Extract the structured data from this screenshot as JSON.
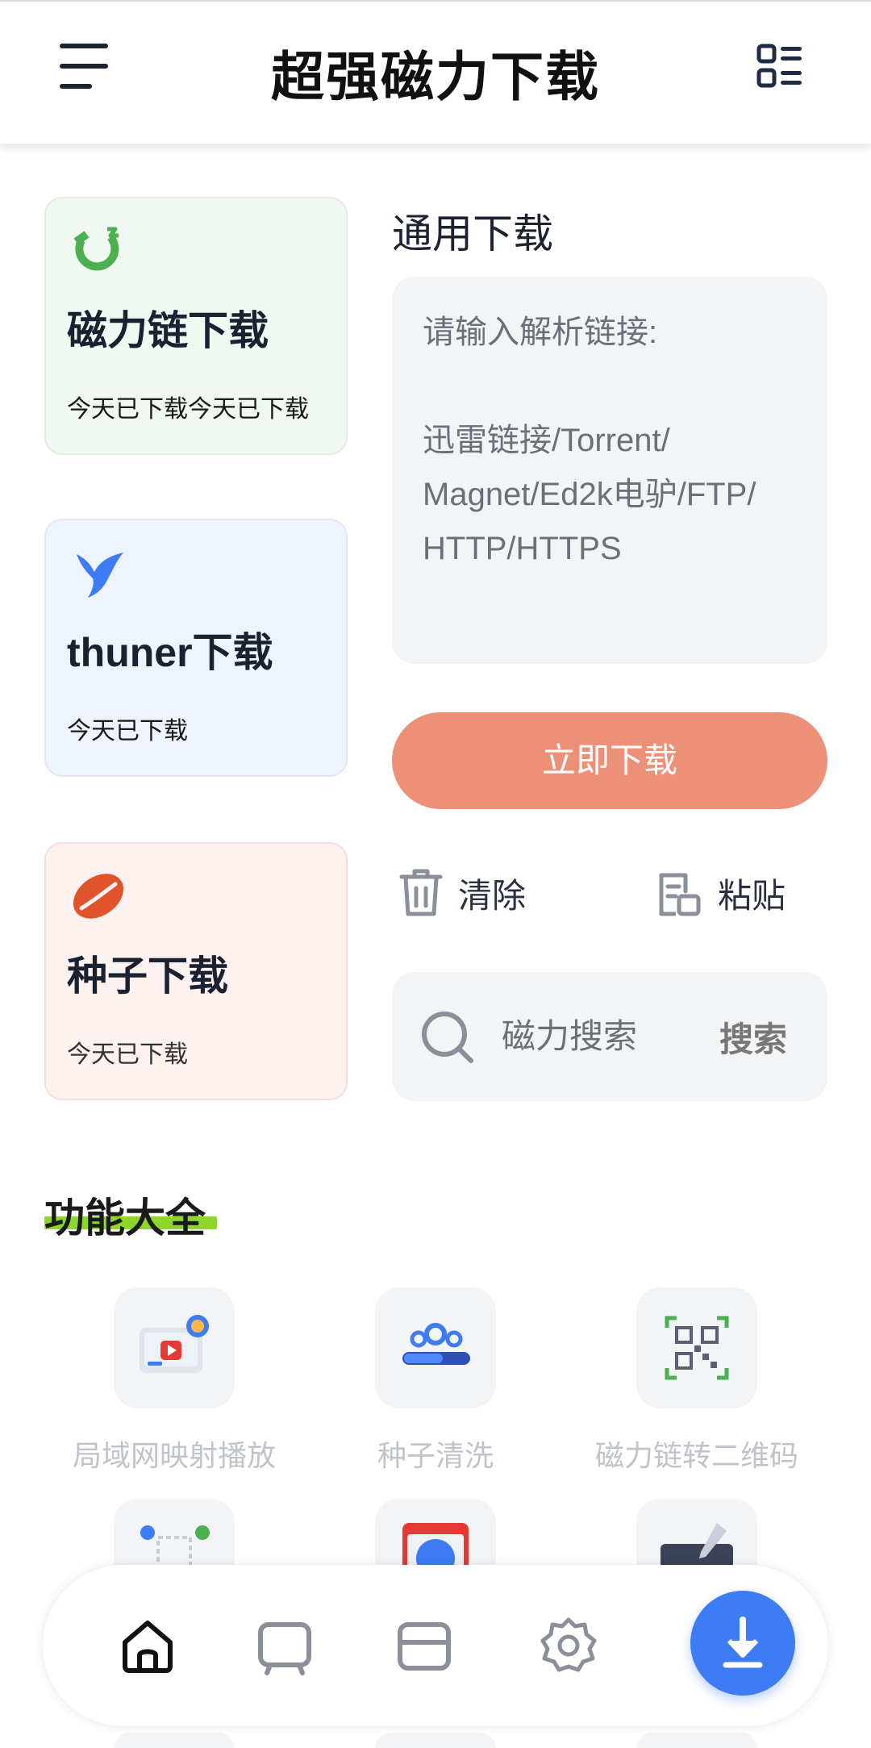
{
  "header": {
    "title": "超强磁力下载",
    "menu_icon": "menu-icon",
    "grid_icon": "list-grid-icon"
  },
  "cards": [
    {
      "title": "磁力链下载",
      "subtitle": "今天已下载今天已下载",
      "icon": "magnet-icon",
      "color": "#4caf50"
    },
    {
      "title": "thuner下载",
      "subtitle": "今天已下载",
      "icon": "bird-icon",
      "color": "#3d7cf5"
    },
    {
      "title": "种子下载",
      "subtitle": "今天已下载",
      "icon": "seed-icon",
      "color": "#e0532b"
    }
  ],
  "download": {
    "section_title": "通用下载",
    "placeholder": "请输入解析链接:\n\n迅雷链接/Torrent/\nMagnet/Ed2k电驴/FTP/\nHTTP/HTTPS",
    "button_label": "立即下载",
    "clear_label": "清除",
    "paste_label": "粘贴"
  },
  "search": {
    "placeholder": "磁力搜索",
    "button_label": "搜索"
  },
  "features": {
    "title": "功能大全",
    "items": [
      {
        "label": "局域网映射播放",
        "icon": "cast-screen-icon"
      },
      {
        "label": "种子清洗",
        "icon": "gears-icon"
      },
      {
        "label": "磁力链转二维码",
        "icon": "qr-code-icon"
      }
    ]
  },
  "bottom_nav": {
    "items": [
      "home-icon",
      "tv-icon",
      "card-icon",
      "settings-icon"
    ],
    "fab_icon": "download-icon"
  },
  "colors": {
    "accent": "#ec9077",
    "fab": "#3d7cf5",
    "feature_underline": "#8ed62b"
  }
}
